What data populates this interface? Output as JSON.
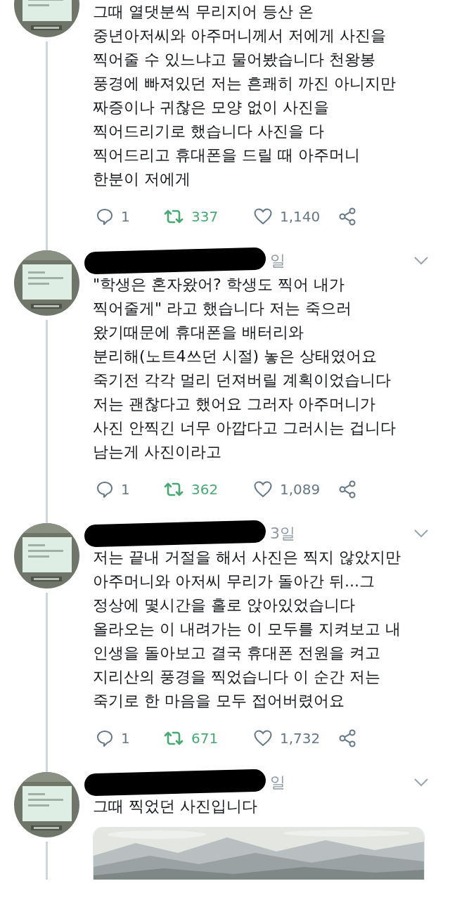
{
  "tweets": [
    {
      "text": "그때 열댓분씩 무리지어 등산 온\n중년아저씨와 아주머니께서 저에게 사진을\n찍어줄 수 있느냐고 물어봤습니다 천왕봉\n풍경에 빠져있던 저는 흔쾌히 까진 아니지만\n짜증이나 귀찮은 모양 없이 사진을\n찍어드리기로 했습니다 사진을 다\n찍어드리고 휴대폰을 드릴 때 아주머니\n한분이 저에게",
      "actions": {
        "reply_count": "1",
        "retweet_count": "337",
        "retweeted": true,
        "like_count": "1,140",
        "liked": false
      }
    },
    {
      "redacted": true,
      "time": "일",
      "text": "\"학생은 혼자왔어? 학생도 찍어 내가\n찍어줄게\" 라고 했습니다 저는 죽으러\n왔기때문에 휴대폰을 배터리와\n분리해(노트4쓰던 시절) 놓은 상태였어요\n죽기전 각각 멀리 던져버릴 계획이었습니다\n저는 괜찮다고 했어요 그러자 아주머니가\n사진 안찍긴 너무 아깝다고 그러시는 겁니다\n남는게 사진이라고",
      "actions": {
        "reply_count": "1",
        "retweet_count": "362",
        "retweeted": true,
        "like_count": "1,089",
        "liked": false
      }
    },
    {
      "redacted": true,
      "time": "3일",
      "text": "저는 끝내 거절을 해서 사진은 찍지 않았지만\n아주머니와 아저씨 무리가 돌아간 뒤...그\n정상에 몇시간을 홀로 앉아있었습니다\n올라오는 이 내려가는 이 모두를 지켜보고 내\n인생을 돌아보고 결국 휴대폰 전원을 켜고\n지리산의 풍경을 찍었습니다 이 순간 저는\n죽기로 한 마음을 모두 접어버렸어요",
      "actions": {
        "reply_count": "1",
        "retweet_count": "671",
        "retweeted": true,
        "like_count": "1,732",
        "liked": false
      }
    },
    {
      "redacted": true,
      "time": "일",
      "text": "그때 찍었던 사진입니다"
    }
  ]
}
